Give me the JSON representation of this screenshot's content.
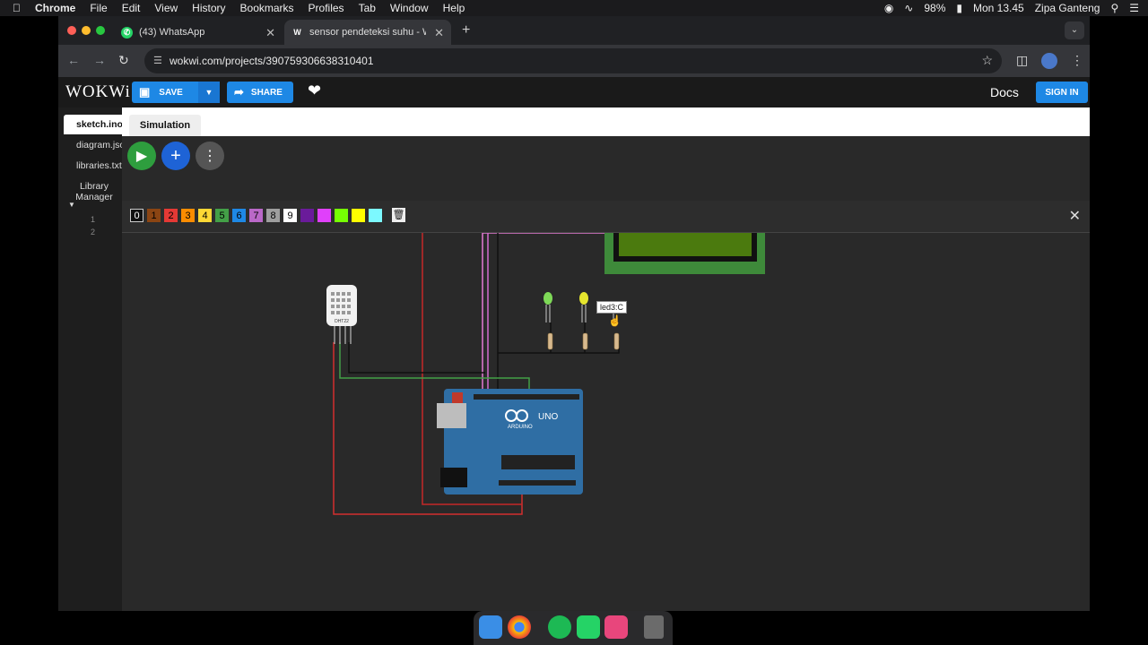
{
  "menubar": {
    "app": "Chrome",
    "items": [
      "File",
      "Edit",
      "View",
      "History",
      "Bookmarks",
      "Profiles",
      "Tab",
      "Window",
      "Help"
    ],
    "battery": "98%",
    "clock": "Mon 13.45",
    "user": "Zipa Ganteng"
  },
  "browser": {
    "tabs": [
      {
        "label": "(43) WhatsApp",
        "icon": "whatsapp-icon"
      },
      {
        "label": "sensor pendeteksi suhu - Wo",
        "icon": "wokwi-icon"
      }
    ],
    "url": "wokwi.com/projects/390759306638310401"
  },
  "wokwi": {
    "logo": "WOKWi",
    "save_label": "SAVE",
    "share_label": "SHARE",
    "docs_label": "Docs",
    "signin_label": "SIGN IN",
    "files": [
      "sketch.ino",
      "diagram.json",
      "libraries.txt"
    ],
    "library_manager": "Library Manager",
    "sim_tab": "Simulation",
    "line_numbers": [
      "1",
      "2"
    ],
    "wire_colors": [
      {
        "label": "0",
        "color": "#111111",
        "text": "#ffffff"
      },
      {
        "label": "1",
        "color": "#8b4513",
        "text": "#000000"
      },
      {
        "label": "2",
        "color": "#e53935",
        "text": "#000000"
      },
      {
        "label": "3",
        "color": "#fb8c00",
        "text": "#000000"
      },
      {
        "label": "4",
        "color": "#fdd835",
        "text": "#000000"
      },
      {
        "label": "5",
        "color": "#43a047",
        "text": "#000000"
      },
      {
        "label": "6",
        "color": "#1e88e5",
        "text": "#000000"
      },
      {
        "label": "7",
        "color": "#ba68c8",
        "text": "#000000"
      },
      {
        "label": "8",
        "color": "#9e9e9e",
        "text": "#000000"
      },
      {
        "label": "9",
        "color": "#ffffff",
        "text": "#000000"
      },
      {
        "label": "",
        "color": "#6a1b9a",
        "text": "#000000"
      },
      {
        "label": "",
        "color": "#e040fb",
        "text": "#000000"
      },
      {
        "label": "",
        "color": "#76ff03",
        "text": "#000000"
      },
      {
        "label": "",
        "color": "#ffff00",
        "text": "#000000"
      },
      {
        "label": "",
        "color": "#7cf9ff",
        "text": "#000000"
      }
    ],
    "tooltip": "led3:C",
    "sensor_label": "DHT22",
    "board_brand": "ARDUINO",
    "board_model": "UNO"
  },
  "colors": {
    "accent": "#1e88e5",
    "board": "#2f6ea4",
    "lcd": "#3e8a3a"
  }
}
